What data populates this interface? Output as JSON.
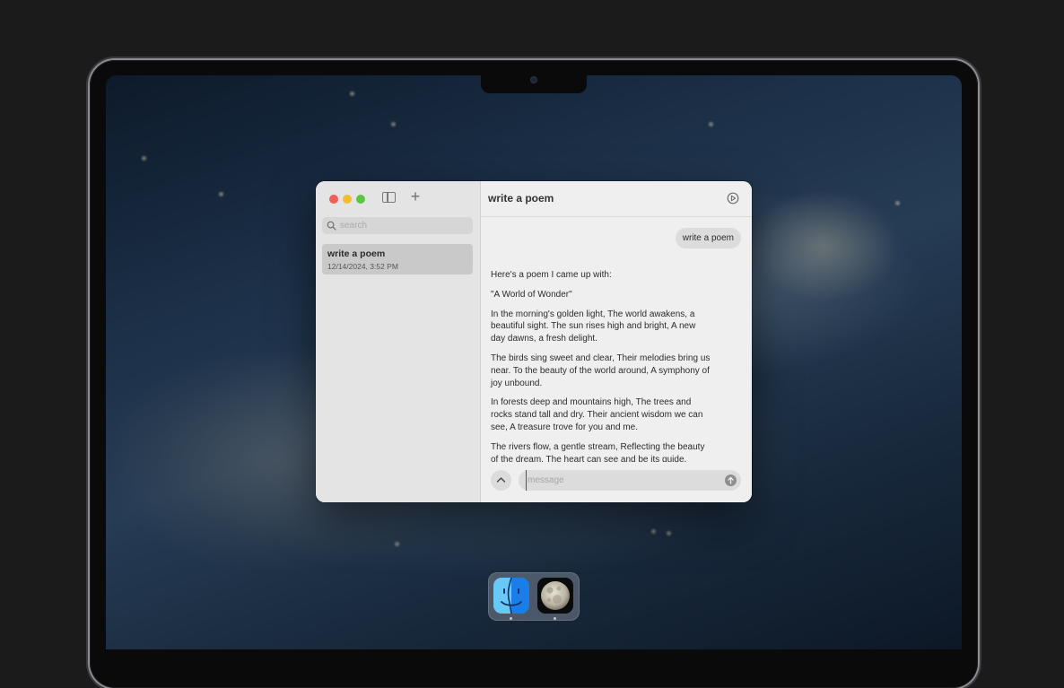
{
  "sidebar": {
    "search_placeholder": "search",
    "chats": [
      {
        "title": "write a poem",
        "date": "12/14/2024, 3:52 PM"
      }
    ]
  },
  "chat": {
    "title": "write a poem",
    "user_message": "write a poem",
    "assistant_paragraphs": [
      "Here's a poem I came up with:",
      "\"A World of Wonder\"",
      "In the morning's golden light, The world awakens, a beautiful sight. The sun rises high and bright, A new day dawns, a fresh delight.",
      "The birds sing sweet and clear, Their melodies bring us near. To the beauty of the world around, A symphony of joy unbound.",
      "In forests deep and mountains high, The trees and rocks stand tall and dry. Their ancient wisdom we can see, A treasure trove for you and me.",
      "The rivers flow, a gentle stream, Reflecting the beauty of the dream. The heart can see and be its guide,"
    ]
  },
  "composer": {
    "message_placeholder": "message"
  },
  "dock": {
    "apps": [
      "finder-icon",
      "moon-app-icon"
    ]
  },
  "colors": {
    "close": "#ee5f57",
    "minimize": "#f4bc2f",
    "zoom": "#5bc640"
  }
}
